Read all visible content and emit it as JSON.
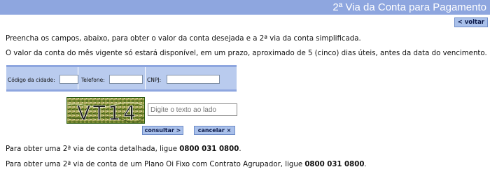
{
  "header": {
    "title": "2ª Via da Conta para Pagamento",
    "bar_color": "#8ea6df"
  },
  "nav": {
    "back_label": "< voltar"
  },
  "intro": {
    "line1": "Preencha os campos, abaixo, para obter o valor da conta desejada e a 2ª via da conta simplificada.",
    "line2": "O valor da conta do mês vigente só estará disponível, em um prazo, aproximado de 5 (cinco) dias úteis, antes da data do vencimento."
  },
  "form": {
    "fields": [
      {
        "label": "Código da cidade:",
        "value": ""
      },
      {
        "label": "Telefone:",
        "value": ""
      },
      {
        "label": "CNPJ:",
        "value": ""
      }
    ],
    "captcha": {
      "image_text": "VT14",
      "placeholder": "Digite o texto ao lado",
      "value": ""
    },
    "submit_label": "consultar >",
    "cancel_label": "cancelar ×"
  },
  "footer": {
    "detailed": {
      "text": "Para obter uma 2ª via de conta detalhada, ligue ",
      "phone": "0800 031 0800",
      "suffix": "."
    },
    "group": {
      "text": "Para obter uma 2ª via de conta de um Plano Oi Fixo com Contrato Agrupador, ligue ",
      "phone": "0800 031 0800",
      "suffix": "."
    }
  }
}
